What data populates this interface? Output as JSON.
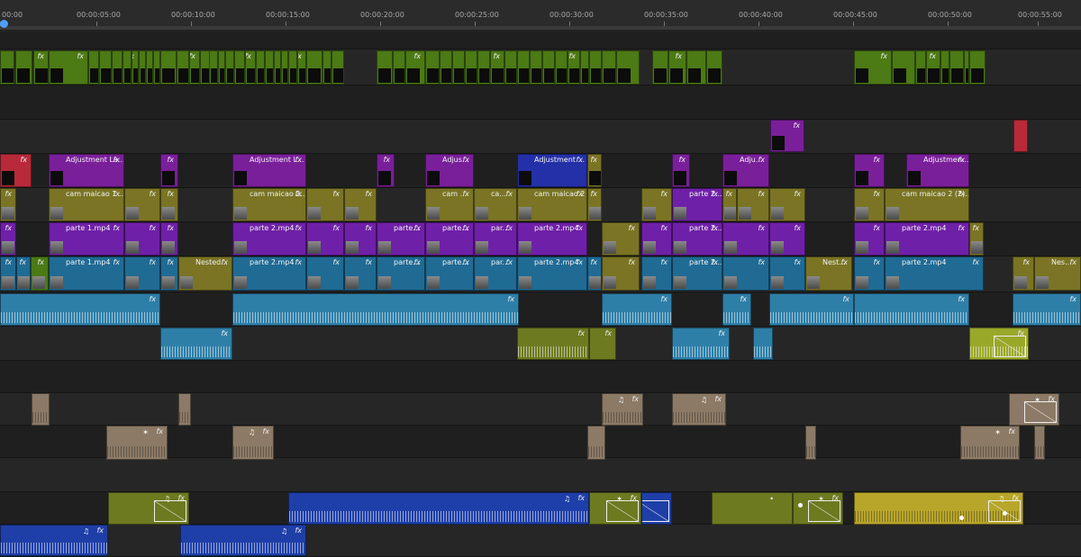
{
  "ruler": {
    "ticks": [
      "00:00",
      "00:00:05:00",
      "00:00:10:00",
      "00:00:15:00",
      "00:00:20:00",
      "00:00:25:00",
      "00:00:30:00",
      "00:00:35:00",
      "00:00:40:00",
      "00:00:45:00",
      "00:00:50:00",
      "00:00:55:00"
    ]
  },
  "colors": {
    "video_green": "#4c7a14",
    "adjustment_purple": "#7a1f9a",
    "olive": "#7a7424",
    "clip_purple": "#6f20a8",
    "clip_teal": "#1f6b94",
    "audio_cyan": "#2e7fa8",
    "audio_tan": "#8c7a66",
    "audio_olive": "#6d7a20",
    "audio_blue": "#1f3fa8",
    "clip_red": "#b82a3a",
    "playhead": "#4aa0ff"
  },
  "labels": {
    "fx": "fx",
    "adjustment_layer_1": "Adjustment La...",
    "adjustment_layer_2": "Adjustment L...",
    "adjustment_short": "Adjus...",
    "adjustment_blue": "Adjustment ...",
    "adjustment_tiny": "Adju...",
    "adjustment_end": "Adjustmen...",
    "cam1": "cam maicao 1 ...",
    "cam2": "cam maicao 2...",
    "cam_short": "cam ...",
    "ca": "ca...",
    "cam3": "cam maicao 2",
    "parte2_short": "parte 2...",
    "cam4": "cam maicao 2 (2)...",
    "parte1": "parte 1.mp4",
    "parte2": "parte 2.mp4",
    "parte_short": "parte...",
    "par": "par...",
    "nested": "Nested...",
    "nest": "Nest...",
    "nes": "Nes..."
  },
  "icons": {
    "music": "music-note-icon",
    "sparkle": "sparkle-effect-icon",
    "volume": "volume-icon"
  }
}
